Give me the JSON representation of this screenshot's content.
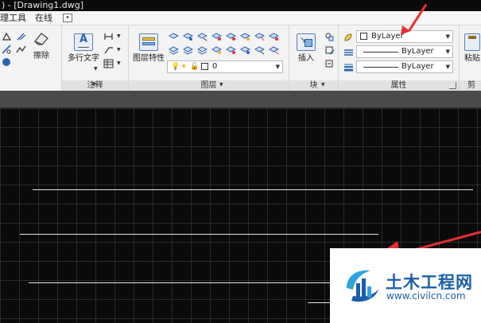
{
  "window": {
    "title": ") - [Drawing1.dwg]"
  },
  "menu": {
    "items": [
      "理工具",
      "在线"
    ],
    "overflow_label": "▾"
  },
  "ribbon": {
    "annotation": {
      "title": "注释",
      "mtext_label": "多行文字",
      "erase_label": "擦除"
    },
    "layers": {
      "title": "图层",
      "properties_label": "图层特性",
      "current_layer": "0"
    },
    "block": {
      "title": "块",
      "insert_label": "插入"
    },
    "properties": {
      "title": "属性",
      "color": "ByLayer",
      "linetype": "ByLayer",
      "lineweight": "ByLayer"
    },
    "clipboard": {
      "title_partial": "剪",
      "paste_label": "粘贴"
    }
  },
  "watermark": {
    "title": "土木工程网",
    "url": "www.civilcn.com"
  },
  "colors": {
    "accent_red": "#e53030",
    "watermark_blue": "#1b5fa8",
    "canvas_bg": "#0a0a0a"
  }
}
